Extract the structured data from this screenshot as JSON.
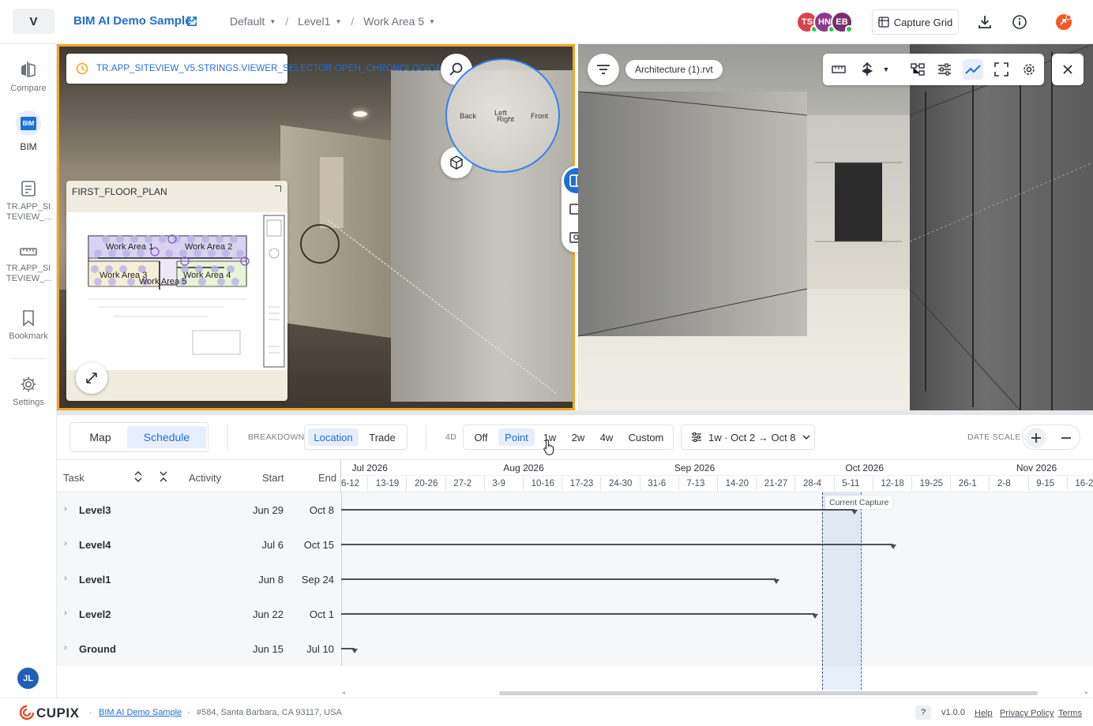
{
  "header": {
    "brand_letter": "V",
    "project_title": "BIM AI Demo Sample",
    "breadcrumbs": [
      "Default",
      "Level1",
      "Work Area 5"
    ],
    "collaborators": [
      {
        "initials": "TS",
        "color": "#d9434f"
      },
      {
        "initials": "HN",
        "color": "#8e3a8c"
      },
      {
        "initials": "EB",
        "color": "#7a2f6b"
      }
    ],
    "capture_grid_label": "Capture Grid"
  },
  "sidebar": {
    "items": [
      {
        "label": "Compare"
      },
      {
        "label": "BIM",
        "badge": "BIM"
      },
      {
        "label": "TR.APP_SI TEVIEW_..."
      },
      {
        "label": "TR.APP_SI TEVIEW_..."
      },
      {
        "label": "Bookmark"
      },
      {
        "label": "Settings"
      }
    ],
    "user_initials": "JL"
  },
  "photo_viewer": {
    "selector_text": "TR.APP_SITEVIEW_V5.STRINGS.VIEWER_SELECTOR.OPEN_CHRONOLOGICAL",
    "compass": {
      "back": "Back",
      "left": "Left",
      "right": "Right",
      "front": "Front"
    },
    "minimap": {
      "title": "FIRST_FLOOR_PLAN",
      "areas": [
        "Work Area 1",
        "Work Area 2",
        "Work Area 3",
        "Work Area 4",
        "Work Area 5"
      ]
    }
  },
  "bim_viewer": {
    "model_name": "Architecture (1).rvt"
  },
  "schedule": {
    "tabs": [
      "Map",
      "Schedule"
    ],
    "active_tab": "Schedule",
    "breakdown_label": "BREAKDOWN",
    "breakdown_options": [
      "Location",
      "Trade"
    ],
    "breakdown_active": "Location",
    "fourd_label": "4D",
    "fourd_options": [
      "Off",
      "Point",
      "1w",
      "2w",
      "4w",
      "Custom"
    ],
    "fourd_active": "Point",
    "range_text": "1w · Oct 2 → Oct 8",
    "date_scale_label": "DATE SCALE",
    "columns": {
      "task": "Task",
      "activity": "Activity",
      "start": "Start",
      "end": "End"
    },
    "months": [
      "Jul 2026",
      "Aug 2026",
      "Sep 2026",
      "Oct 2026",
      "Nov 2026"
    ],
    "weeks": [
      "6-12",
      "13-19",
      "20-26",
      "27-2",
      "3-9",
      "10-16",
      "17-23",
      "24-30",
      "31-6",
      "7-13",
      "14-20",
      "21-27",
      "28-4",
      "5-11",
      "12-18",
      "19-25",
      "26-1",
      "2-8",
      "9-15",
      "16-2"
    ],
    "rows": [
      {
        "name": "Level3",
        "start": "Jun 29",
        "end": "Oct 8"
      },
      {
        "name": "Level4",
        "start": "Jul 6",
        "end": "Oct 15"
      },
      {
        "name": "Level1",
        "start": "Jun 8",
        "end": "Sep 24"
      },
      {
        "name": "Level2",
        "start": "Jun 22",
        "end": "Oct 1"
      },
      {
        "name": "Ground",
        "start": "Jun 15",
        "end": "Jul 10"
      }
    ],
    "current_capture_label": "Current Capture"
  },
  "footer": {
    "logo": "CUPIX",
    "project_link": "BIM AI Demo Sample",
    "address": "#584, Santa Barbara, CA 93117, USA",
    "help_glyph": "?",
    "version": "v1.0.0",
    "links": [
      "Help",
      "Privacy Policy",
      "Terms"
    ]
  }
}
